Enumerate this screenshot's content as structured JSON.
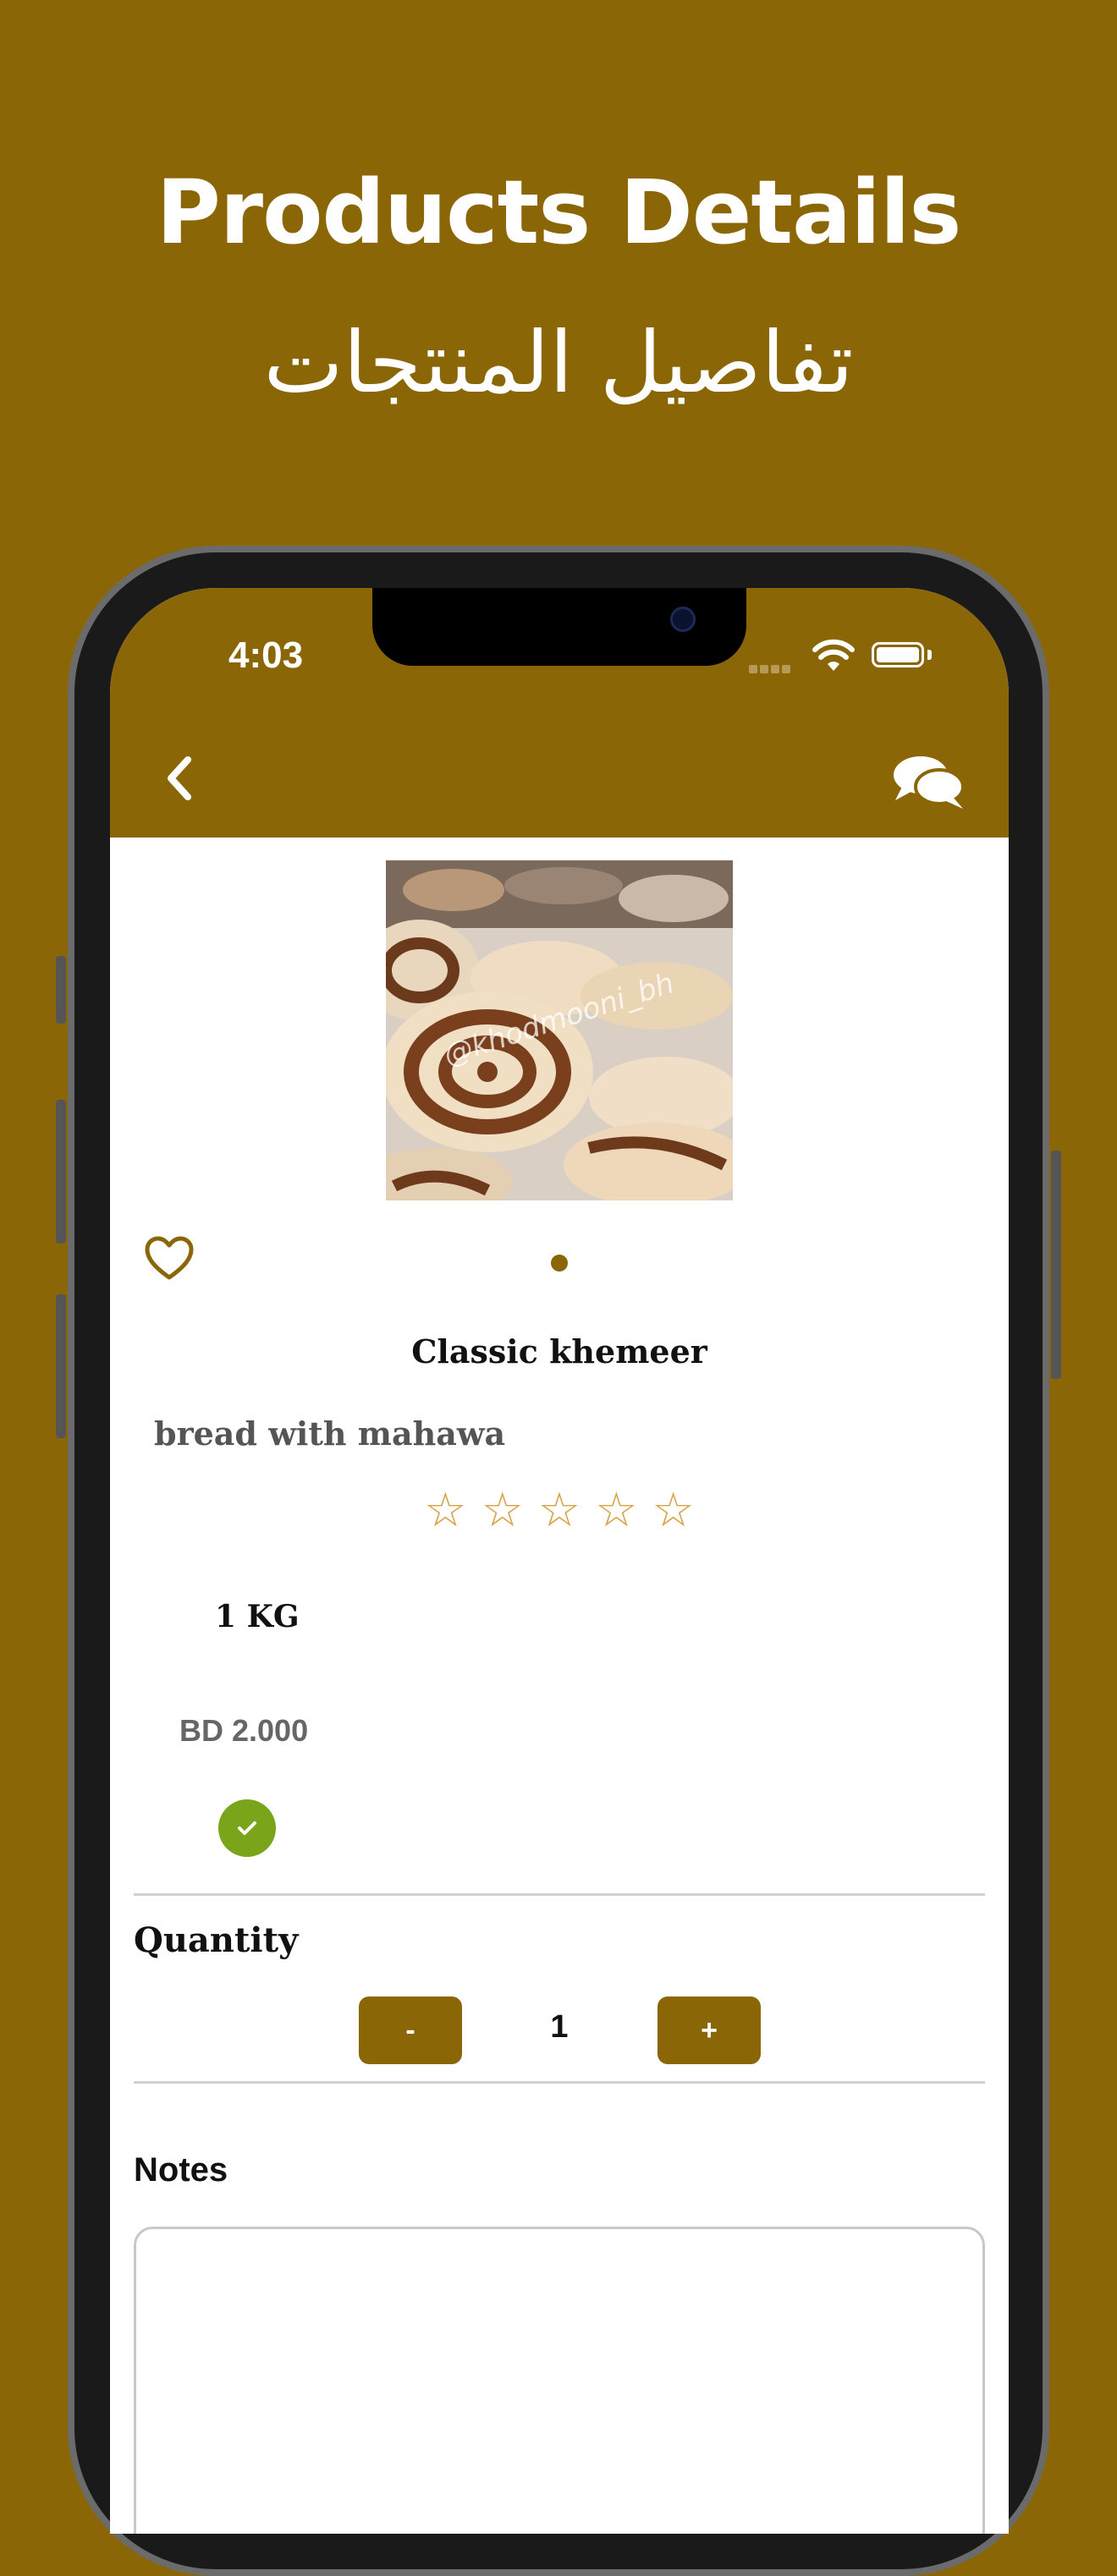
{
  "promo": {
    "title_en": "Products Details",
    "title_ar": "تفاصيل المنتجات"
  },
  "status_bar": {
    "time": "4:03"
  },
  "nav": {
    "back_icon": "chevron-left-icon",
    "chat_icon": "chat-bubbles-icon"
  },
  "product": {
    "image_caption": "@khodmooni_bh",
    "name": "Classic khemeer",
    "description": "bread with mahawa",
    "rating": 0,
    "rating_max": 5,
    "star_glyph": "☆",
    "weight": "1 KG",
    "price": "BD 2.000",
    "selected": true
  },
  "quantity": {
    "label": "Quantity",
    "minus": "-",
    "value": "1",
    "plus": "+"
  },
  "notes": {
    "label": "Notes",
    "value": ""
  },
  "colors": {
    "brand": "#8a6606",
    "accent_check": "#7aa51a",
    "star": "#d7a24a"
  }
}
